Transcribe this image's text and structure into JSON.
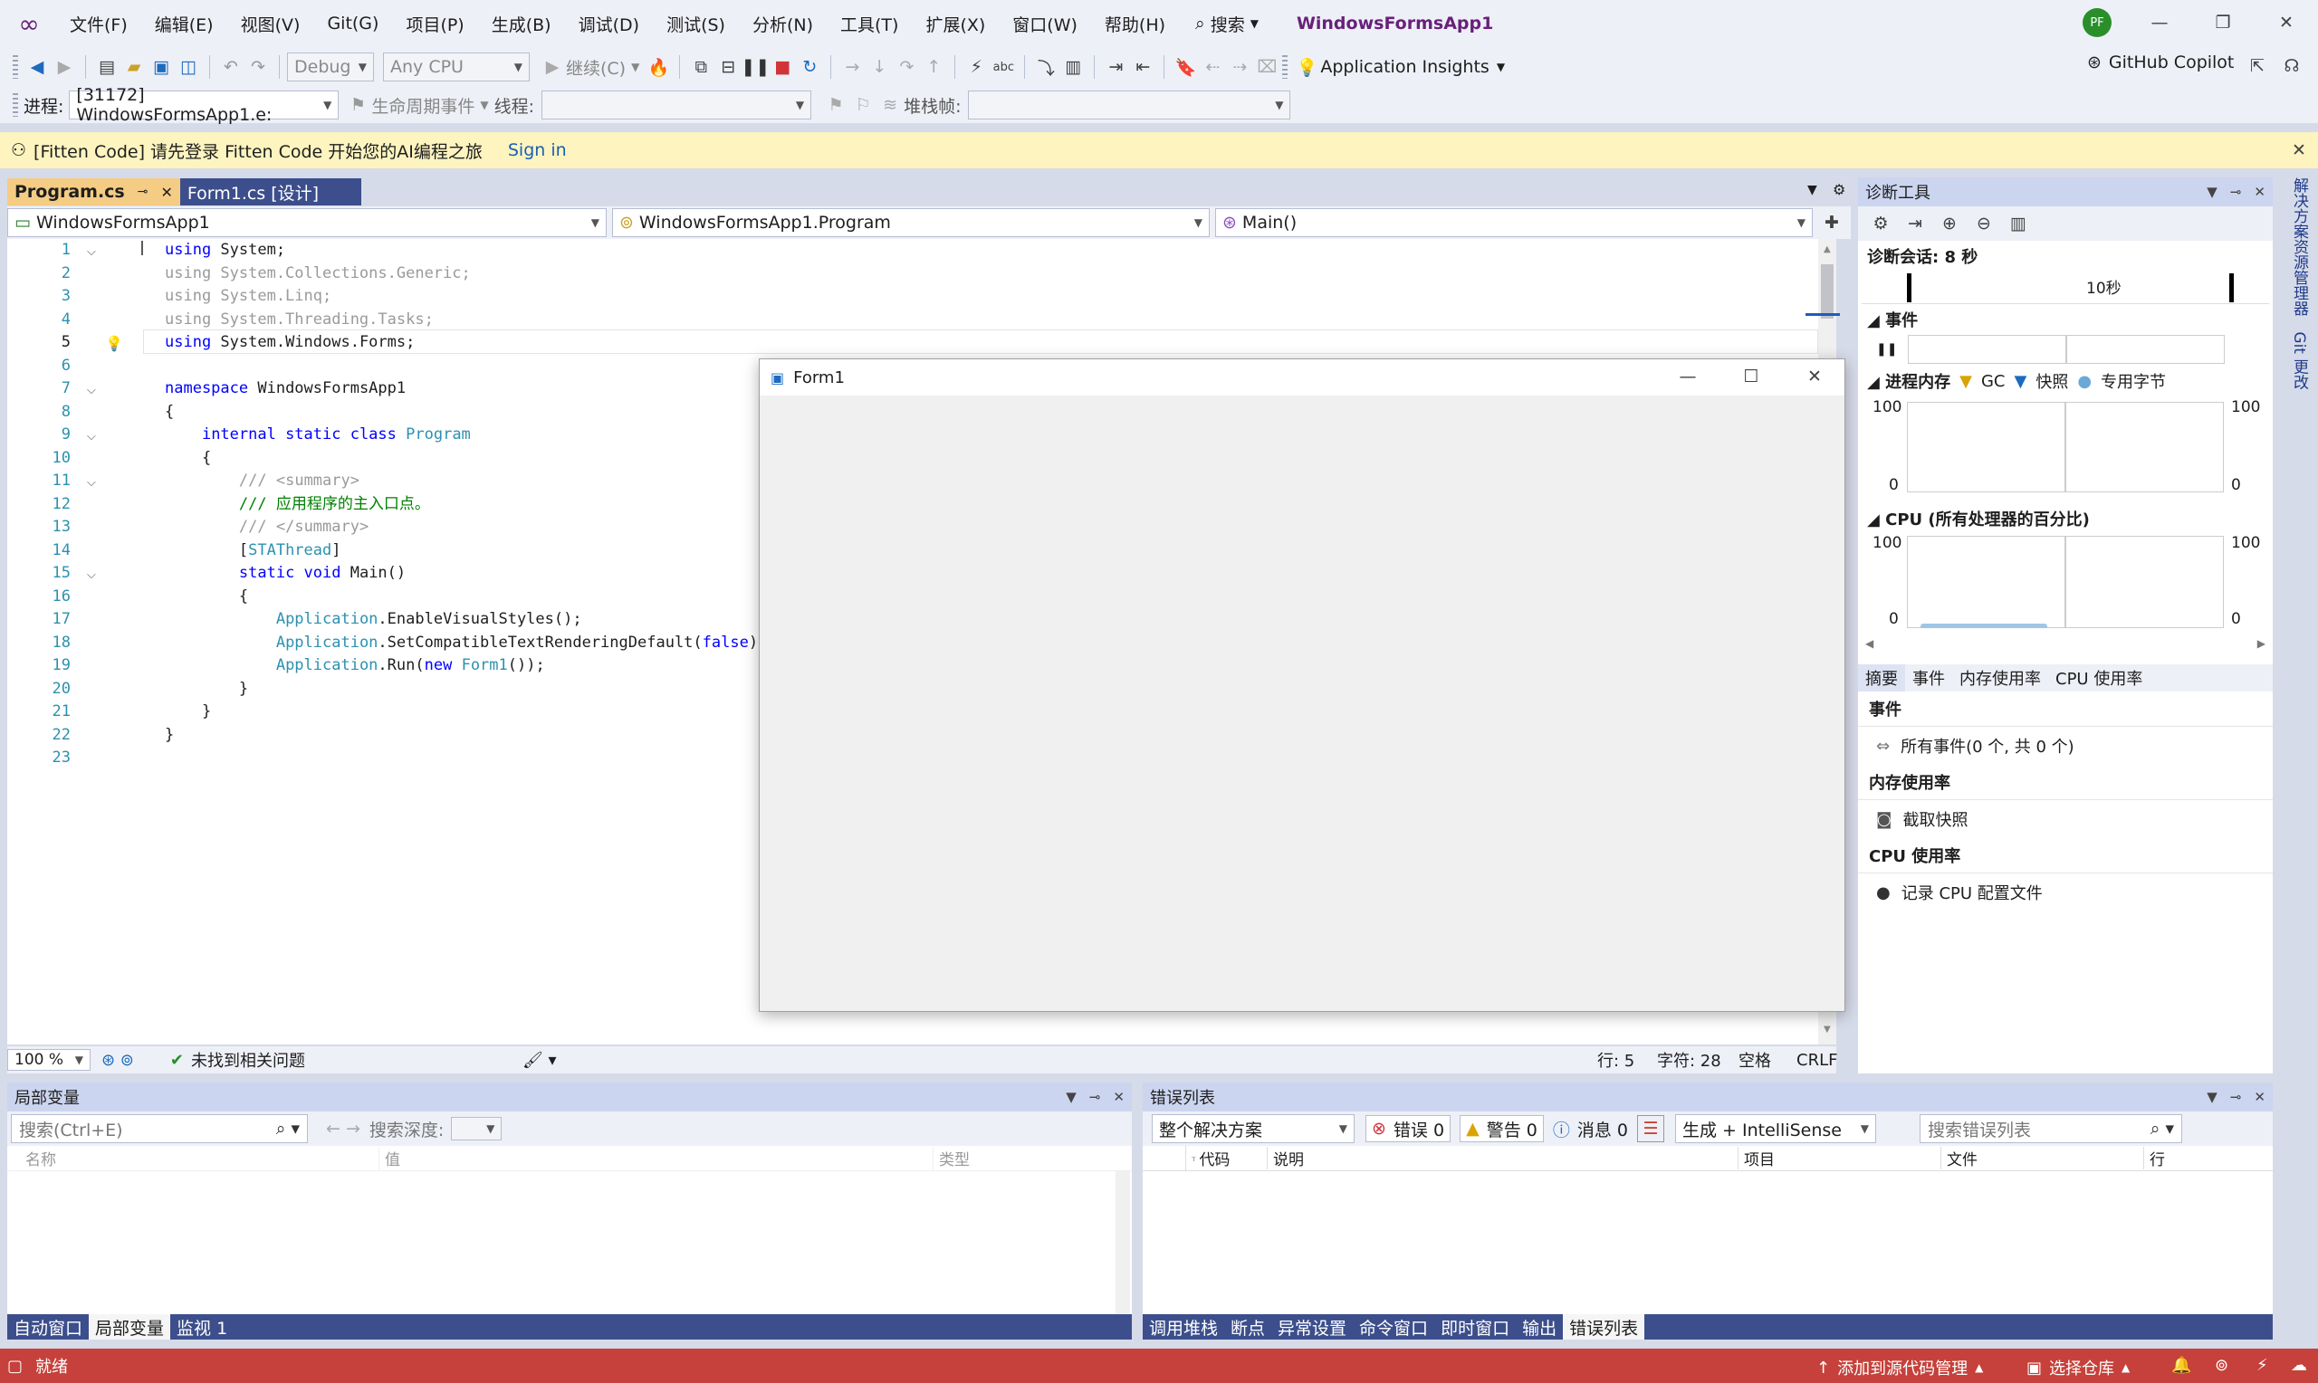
{
  "menu": {
    "items": [
      "文件(F)",
      "编辑(E)",
      "视图(V)",
      "Git(G)",
      "项目(P)",
      "生成(B)",
      "调试(D)",
      "测试(S)",
      "分析(N)",
      "工具(T)",
      "扩展(X)",
      "窗口(W)",
      "帮助(H)"
    ],
    "search": "搜索",
    "solution": "WindowsFormsApp1",
    "avatar": "PF"
  },
  "toolbar": {
    "config": "Debug",
    "platform": "Any CPU",
    "continue": "继续(C)",
    "insights": "Application Insights",
    "copilot": "GitHub Copilot"
  },
  "toolbar2": {
    "process_label": "进程:",
    "process": "[31172] WindowsFormsApp1.e:",
    "lifecycle": "生命周期事件",
    "thread_label": "线程:",
    "stack_label": "堆栈帧:"
  },
  "notice": {
    "text": "[Fitten Code] 请先登录 Fitten Code 开始您的AI编程之旅",
    "link": "Sign in"
  },
  "editor": {
    "tabs": [
      "Program.cs",
      "Form1.cs [设计]"
    ],
    "nav": [
      "WindowsFormsApp1",
      "WindowsFormsApp1.Program",
      "Main()"
    ],
    "line_numbers": [
      "1",
      "2",
      "3",
      "4",
      "5",
      "6",
      "7",
      "8",
      "9",
      "10",
      "11",
      "12",
      "13",
      "14",
      "15",
      "16",
      "17",
      "18",
      "19",
      "20",
      "21",
      "22",
      "23"
    ],
    "status": {
      "zoom": "100 %",
      "issues": "未找到相关问题",
      "line": "行: 5",
      "col": "字符: 28",
      "ws": "空格",
      "eol": "CRLF"
    }
  },
  "form1": {
    "title": "Form1"
  },
  "diag": {
    "title": "诊断工具",
    "session": "诊断会话: 8 秒",
    "tick": "10秒",
    "events_label": "事件",
    "memory_label": "进程内存",
    "gc": "GC",
    "snapshot": "快照",
    "private": "专用字节",
    "cpu_label": "CPU (所有处理器的百分比)",
    "max": "100",
    "min": "0",
    "tabs": [
      "摘要",
      "事件",
      "内存使用率",
      "CPU 使用率"
    ],
    "sections": [
      {
        "title": "事件",
        "item": "所有事件(0 个, 共 0 个)"
      },
      {
        "title": "内存使用率",
        "item": "截取快照"
      },
      {
        "title": "CPU 使用率",
        "item": "记录 CPU 配置文件"
      }
    ]
  },
  "side_tabs": [
    "解决方案资源管理器",
    "Git 更改"
  ],
  "locals": {
    "title": "局部变量",
    "search": "搜索(Ctrl+E)",
    "depth": "搜索深度:",
    "cols": [
      "名称",
      "值",
      "类型"
    ],
    "tabs": [
      "自动窗口",
      "局部变量",
      "监视 1"
    ]
  },
  "errors": {
    "title": "错误列表",
    "scope": "整个解决方案",
    "err": "错误 0",
    "warn": "警告 0",
    "msg": "消息 0",
    "source": "生成 + IntelliSense",
    "search": "搜索错误列表",
    "cols": [
      "代码",
      "说明",
      "项目",
      "文件",
      "行"
    ],
    "tabs": [
      "调用堆栈",
      "断点",
      "异常设置",
      "命令窗口",
      "即时窗口",
      "输出",
      "错误列表"
    ]
  },
  "statusbar": {
    "ready": "就绪",
    "source_ctl": "添加到源代码管理",
    "repo": "选择仓库"
  },
  "colors": {
    "status": "#c6413b",
    "accent": "#ccd5f0",
    "tab_active": "#f5cc84"
  }
}
